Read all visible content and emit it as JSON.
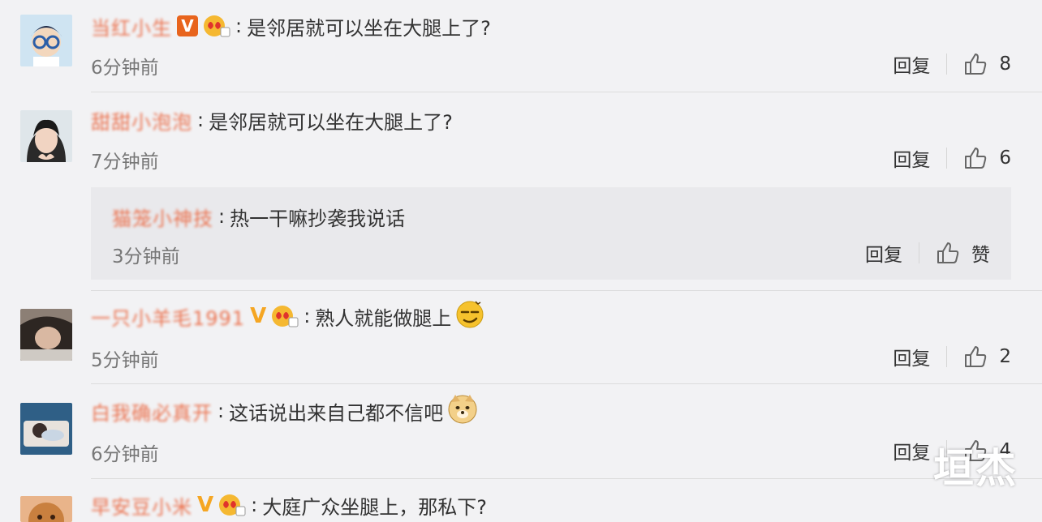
{
  "colors": {
    "username": "#eb7350",
    "verified_box": "#e8641d",
    "verified_plain": "#f5a623",
    "background": "#f2f2f4",
    "reply_box": "#e9e9ec"
  },
  "comments": [
    {
      "username": "当红小生",
      "badges": [
        "verified-box-icon",
        "fan-badge-icon"
      ],
      "text": "是邻居就可以坐在大腿上了?",
      "time": "6分钟前",
      "reply_label": "回复",
      "likes": "8"
    },
    {
      "username": "甜甜小泡泡",
      "badges": [],
      "text": "是邻居就可以坐在大腿上了?",
      "time": "7分钟前",
      "reply_label": "回复",
      "likes": "6"
    },
    {
      "username": "一只小羊毛1991",
      "badges": [
        "verified-v-icon",
        "fan-badge-icon"
      ],
      "text": "熟人就能做腿上",
      "emoji": "smirk-emoji-icon",
      "time": "5分钟前",
      "reply_label": "回复",
      "likes": "2"
    },
    {
      "username": "白我确必真开",
      "badges": [],
      "text": "这话说出来自己都不信吧",
      "emoji": "doge-emoji-icon",
      "time": "6分钟前",
      "reply_label": "回复",
      "likes": "4"
    },
    {
      "username": "早安豆小米",
      "badges": [
        "verified-v-icon",
        "fan-badge-icon"
      ],
      "text": "大庭广众坐腿上，那私下?"
    }
  ],
  "subreply": {
    "username": "猫笼小神技",
    "text": "热一干嘛抄袭我说话",
    "time": "3分钟前",
    "reply_label": "回复",
    "like_label": "赞"
  },
  "watermark": "垣杰"
}
